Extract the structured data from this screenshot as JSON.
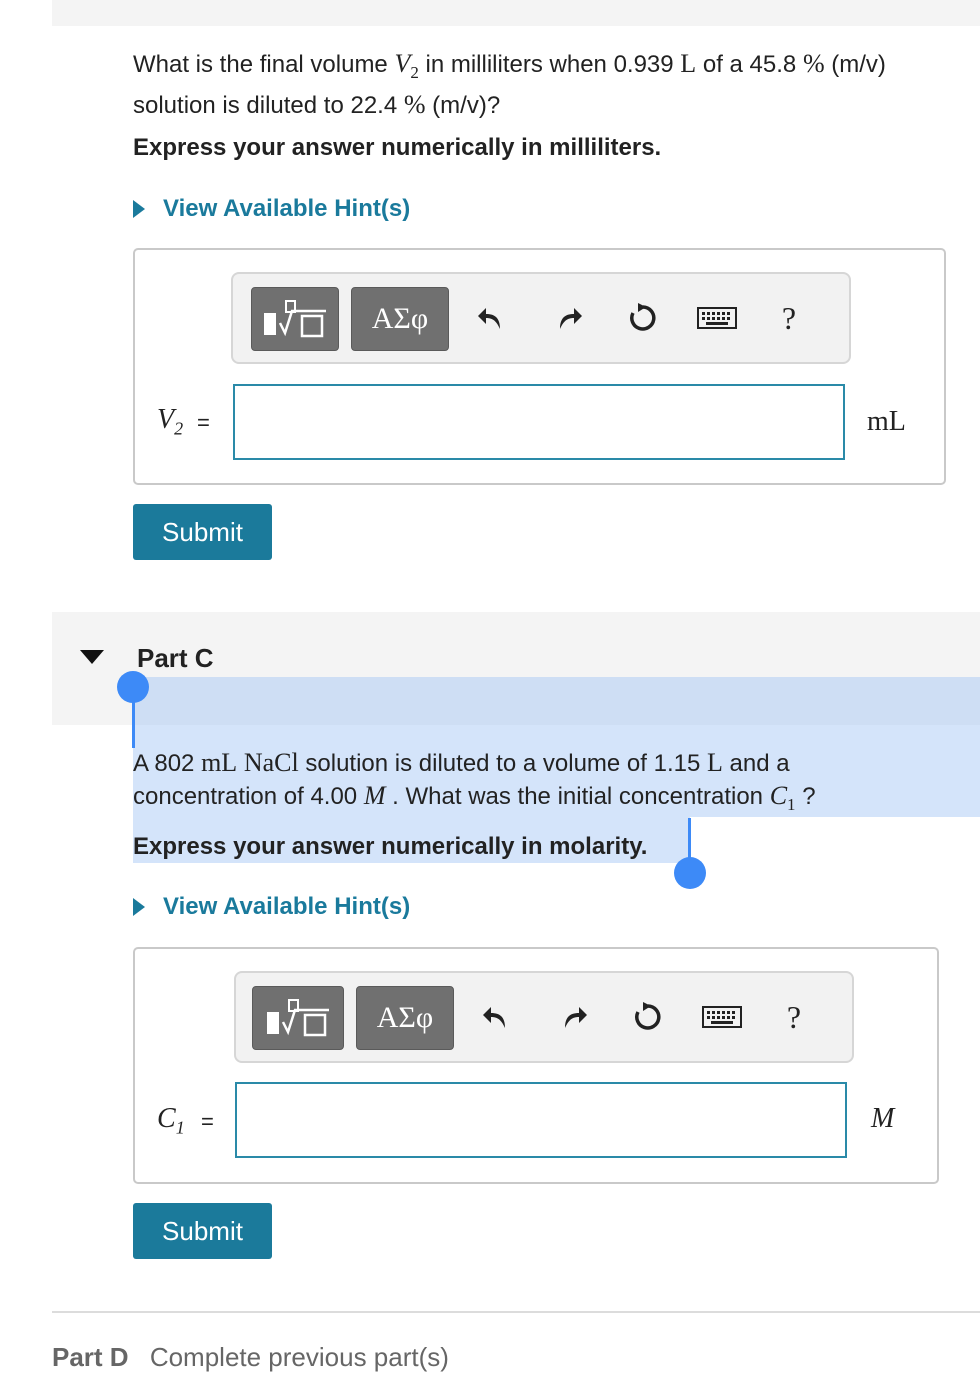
{
  "partB": {
    "question_line1_a": "What is the final volume ",
    "var_v2_letter": "V",
    "var_v2_sub": "2",
    "question_line1_b": " in milliliters when 0.939 ",
    "unit_L": "L",
    "question_line1_c": " of a 45.8 ",
    "pct": "%",
    "question_line1_d": " (m/v)",
    "question_line2_a": "solution is diluted to 22.4 ",
    "question_line2_b": " (m/v)?",
    "instruction": "Express your answer numerically in milliliters.",
    "hint_label": "View Available Hint(s)",
    "answer_var": "V",
    "answer_var_sub": "2",
    "equals": "=",
    "unit": "mL",
    "input_value": "",
    "submit_label": "Submit"
  },
  "partC": {
    "title": "Part C",
    "question_line1_a": "A 802 ",
    "unit_mL": "mL",
    "chem": "NaCl",
    "question_line1_b": " solution is diluted to a volume of 1.15 ",
    "unit_L": "L",
    "question_line1_c": " and a",
    "question_line2_a": "concentration of 4.00 ",
    "unit_M": "M",
    "question_line2_b": " . What was the initial concentration ",
    "var_c1_letter": "C",
    "var_c1_sub": "1",
    "question_line2_c": " ?",
    "instruction": "Express your answer numerically in molarity.",
    "hint_label": "View Available Hint(s)",
    "answer_var": "C",
    "answer_var_sub": "1",
    "equals": "=",
    "unit": "M",
    "input_value": "",
    "submit_label": "Submit"
  },
  "toolbar": {
    "greek_label": "ΑΣφ",
    "help_label": "?"
  },
  "partD": {
    "title": "Part D",
    "status": "Complete previous part(s)"
  },
  "colors": {
    "accent": "#1b7a9b",
    "link": "#1a7a9c",
    "selection_handle": "#3d8af7"
  },
  "icons": [
    "templates-icon",
    "undo-icon",
    "redo-icon",
    "reset-icon",
    "keyboard-icon",
    "help-icon",
    "expand-triangle-icon"
  ]
}
